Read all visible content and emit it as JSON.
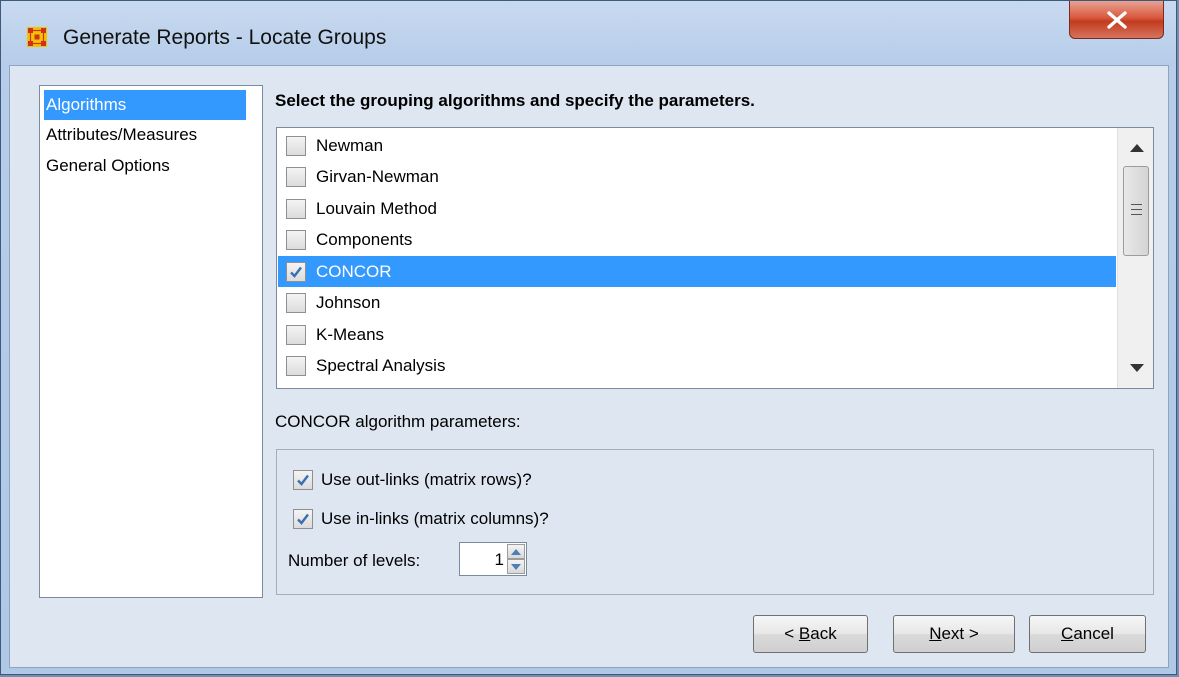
{
  "window": {
    "title": "Generate Reports - Locate Groups",
    "close_label": "X"
  },
  "nav": {
    "items": [
      {
        "label": "Algorithms",
        "selected": true
      },
      {
        "label": "Attributes/Measures",
        "selected": false
      },
      {
        "label": "General Options",
        "selected": false
      }
    ]
  },
  "main": {
    "instruction": "Select the grouping algorithms and specify the parameters.",
    "algorithms": [
      {
        "label": "Newman",
        "checked": false,
        "selected": false
      },
      {
        "label": "Girvan-Newman",
        "checked": false,
        "selected": false
      },
      {
        "label": "Louvain Method",
        "checked": false,
        "selected": false
      },
      {
        "label": "Components",
        "checked": false,
        "selected": false
      },
      {
        "label": "CONCOR",
        "checked": true,
        "selected": true
      },
      {
        "label": "Johnson",
        "checked": false,
        "selected": false
      },
      {
        "label": "K-Means",
        "checked": false,
        "selected": false
      },
      {
        "label": "Spectral Analysis",
        "checked": false,
        "selected": false
      }
    ],
    "params_title": "CONCOR algorithm parameters:",
    "params": {
      "out_links_label": "Use out-links (matrix rows)?",
      "out_links_checked": true,
      "in_links_label": "Use in-links (matrix columns)?",
      "in_links_checked": true,
      "levels_label": "Number of levels:",
      "levels_value": "1"
    }
  },
  "footer": {
    "back_prefix": "< ",
    "back_mnemonic": "B",
    "back_rest": "ack",
    "next_mnemonic": "N",
    "next_rest": "ext >",
    "cancel_mnemonic": "C",
    "cancel_rest": "ancel"
  },
  "colors": {
    "selection": "#3399ff",
    "check": "#3a6fb0",
    "close_button": "#c94a2e"
  }
}
